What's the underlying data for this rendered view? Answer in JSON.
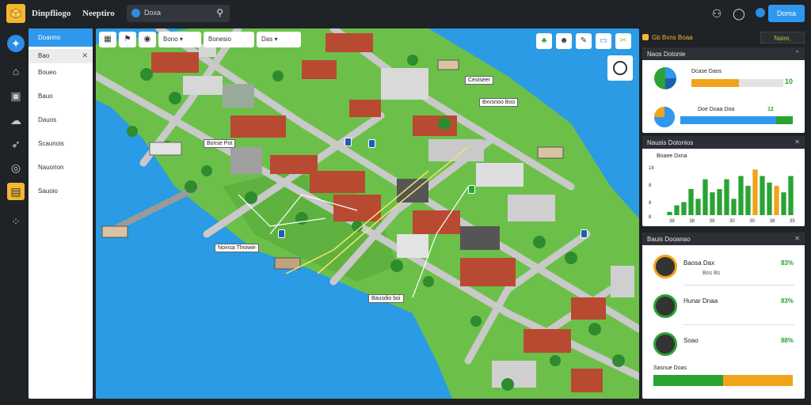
{
  "app": {
    "name": "Dinpfliogo",
    "name2": "Neeptiro",
    "search_text": "Doxa",
    "signup_label": "Doma",
    "colors": {
      "accent": "#f2b630",
      "primary": "#2f97ee",
      "water": "#2a9be4",
      "land": "#6cc04a",
      "dark": "#1f2226"
    }
  },
  "rail": {
    "icons": [
      "globe-icon",
      "home-icon",
      "chart-icon",
      "cloud-icon",
      "rocket-icon",
      "compass-icon",
      "folder-icon",
      "more-icon"
    ]
  },
  "sidebar": {
    "header": "Doanno",
    "selected": "Bao",
    "items": [
      "Boueo",
      "Bauo",
      "Dauos",
      "Scaunois",
      "Nauorion",
      "Sauoio"
    ]
  },
  "map": {
    "toolbar": {
      "dropdown1": "Bono",
      "dropdown2": "Bonesio",
      "dropdown3": "Das"
    },
    "labels": [
      "Noinsa Tlnowie",
      "Bonse Pot",
      "Ceoiseer",
      "Bxvsnoo Boo",
      "Bausdio boi"
    ]
  },
  "right": {
    "section_title": "Gb Bxns Boaa",
    "chip": "Naire,",
    "panel1": {
      "title": "Naos Dotonie",
      "rows": [
        {
          "label": "Dcase Daos",
          "value": "10",
          "fill": 0.52,
          "color": "#f2a31c"
        },
        {
          "label": "Doe Doaa Doa",
          "value": "12",
          "fill": 0.85,
          "color": "#2f97ee"
        }
      ]
    },
    "panel2": {
      "title": "Nausis Dotonios",
      "legend": "Boaee Dxna",
      "chart_data": {
        "type": "bar",
        "values": [
          1,
          3,
          4,
          8,
          5,
          11,
          7,
          8,
          11,
          5,
          12,
          9,
          14,
          12,
          10,
          9,
          7,
          12
        ],
        "colors": [
          "#2aa333",
          "#2aa333",
          "#2aa333",
          "#2aa333",
          "#2aa333",
          "#2aa333",
          "#2aa333",
          "#2aa333",
          "#2aa333",
          "#2aa333",
          "#2aa333",
          "#2aa333",
          "#f2a31c",
          "#2aa333",
          "#2aa333",
          "#f2a31c",
          "#2aa333",
          "#2aa333"
        ],
        "ylim": [
          0,
          16
        ],
        "y_ticks": [
          "18",
          "8",
          "8",
          "8"
        ],
        "x_ticks": [
          "38",
          "38",
          "39",
          "30",
          "30",
          "38",
          "35"
        ]
      }
    },
    "panel3": {
      "title": "Bauis Dooanao",
      "users": [
        {
          "name": "Baosa Dax",
          "sub": "Bos Bs",
          "pct": "83%",
          "ring": "#f2a31c"
        },
        {
          "name": "Hunar Dnaa",
          "sub": "",
          "pct": "83%",
          "ring": "#2aa333"
        },
        {
          "name": "Soao",
          "sub": "",
          "pct": "88%",
          "ring": "#2aa333"
        }
      ],
      "footer_label": "Sasnue Doas",
      "footer": {
        "green": 0.5,
        "orange": 0.5
      }
    }
  }
}
